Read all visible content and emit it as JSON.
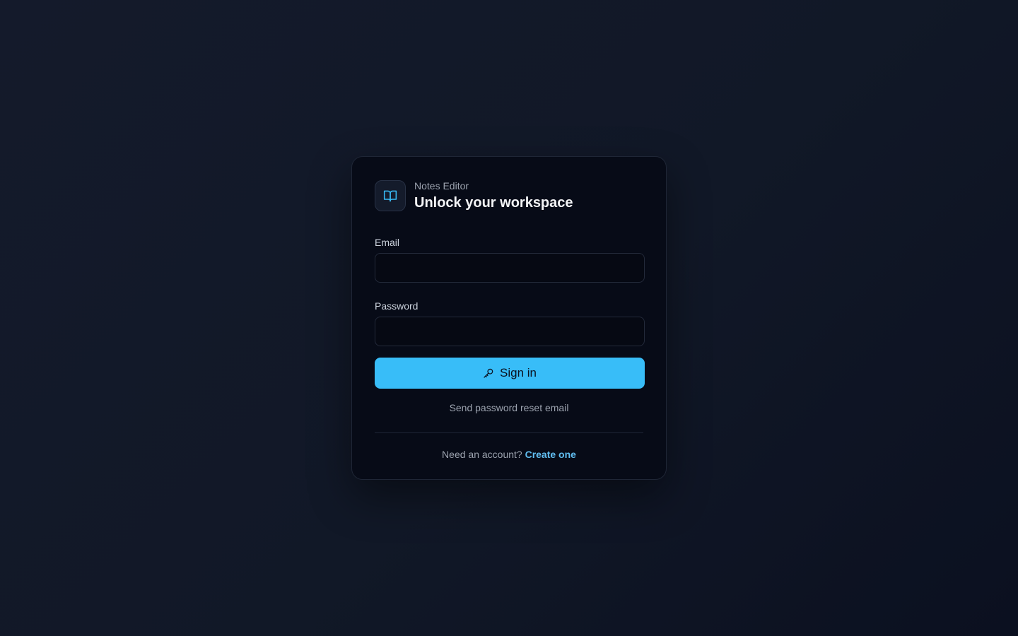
{
  "app": {
    "name": "Notes Editor",
    "headline": "Unlock your workspace",
    "logo_icon": "open-book-icon"
  },
  "form": {
    "email_label": "Email",
    "email_value": "",
    "password_label": "Password",
    "password_value": "",
    "signin_label": "Sign in",
    "signin_icon": "key-icon",
    "reset_link": "Send password reset email"
  },
  "footer": {
    "prompt": "Need an account?",
    "create_link": "Create one"
  },
  "colors": {
    "accent": "#38bdf8",
    "link": "#60bdf0",
    "card_bg": "#070b17",
    "page_bg": "#111827"
  }
}
